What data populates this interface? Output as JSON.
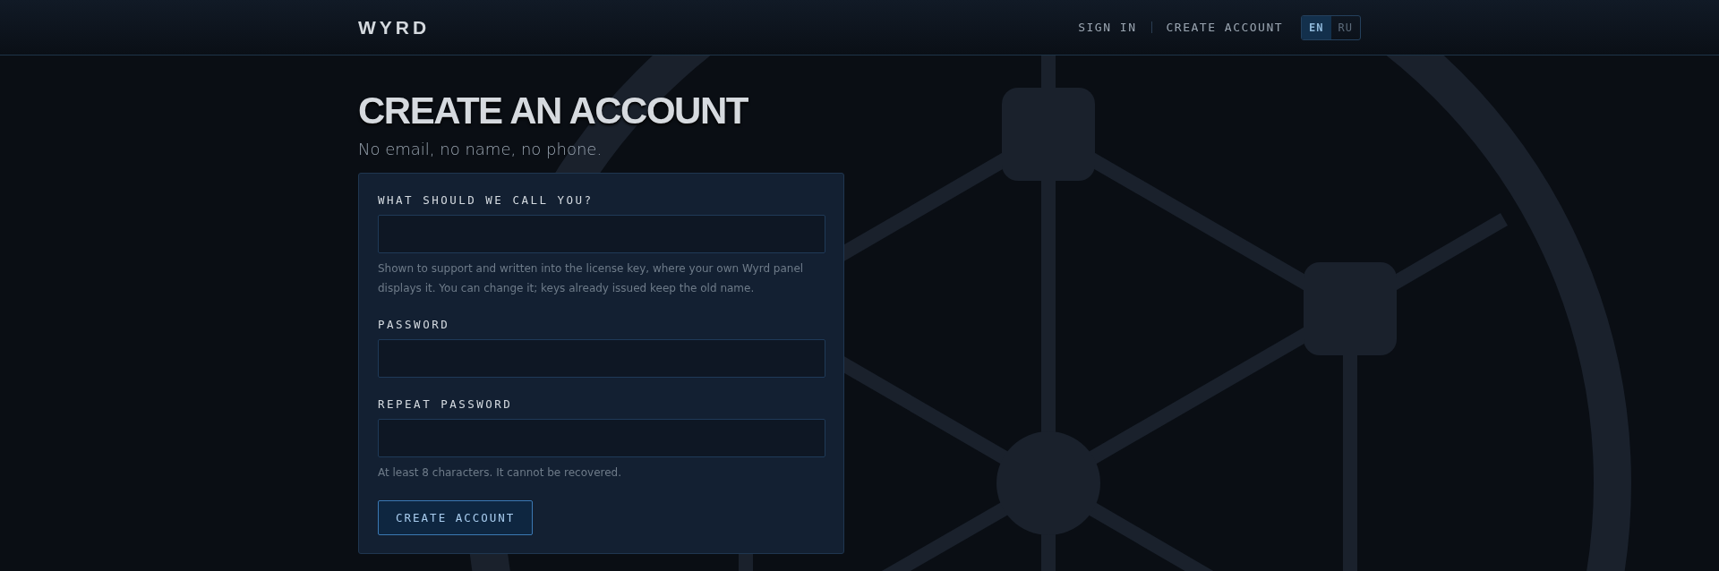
{
  "header": {
    "brand": "WYRD",
    "nav": [
      {
        "label": "SIGN IN"
      },
      {
        "label": "CREATE ACCOUNT"
      }
    ],
    "languages": [
      {
        "label": "EN",
        "selected": true
      },
      {
        "label": "RU",
        "selected": false
      }
    ]
  },
  "page": {
    "title": "CREATE AN ACCOUNT",
    "subtitle": "No email, no name, no phone."
  },
  "form": {
    "fields": [
      {
        "label": "WHAT SHOULD WE CALL YOU?",
        "hint": "Shown to support and written into the license key, where your own Wyrd panel displays it. You can change it; keys already issued keep the old name."
      },
      {
        "label": "PASSWORD"
      },
      {
        "label": "REPEAT PASSWORD",
        "hint": "At least 8 characters. It cannot be recovered."
      }
    ],
    "submit": "CREATE ACCOUNT"
  }
}
